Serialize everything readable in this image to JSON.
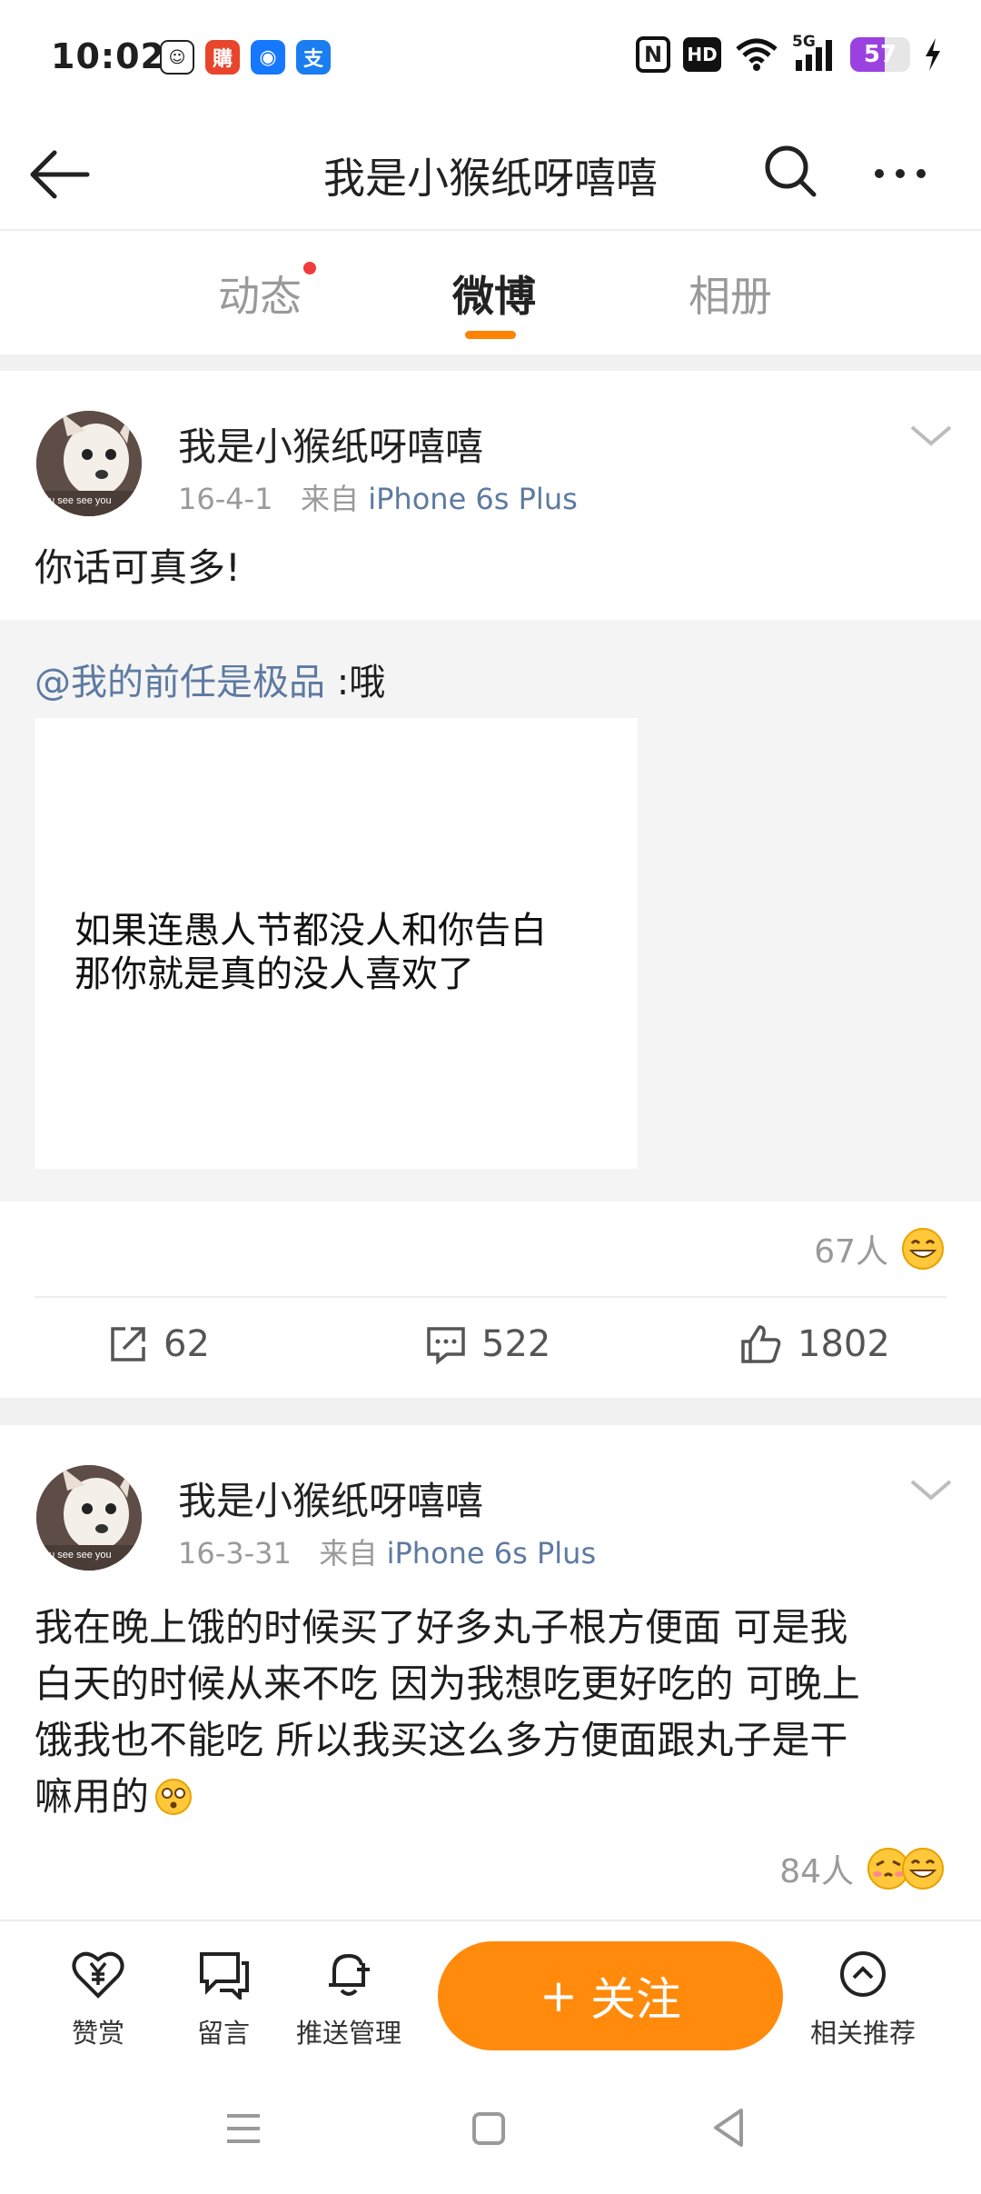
{
  "status_bar": {
    "time": "10:02",
    "app_icons": [
      "wellness-app-icon",
      "shopping-app-icon",
      "alipay-icon",
      "fund-app-icon"
    ],
    "nfc_label": "N",
    "hd_label": "HD",
    "network": "5G",
    "battery_level": 57,
    "battery_label": "57"
  },
  "header": {
    "title": "我是小猴纸呀嘻嘻"
  },
  "tabs": [
    {
      "label": "动态",
      "has_dot": true
    },
    {
      "label": "微博",
      "active": true
    },
    {
      "label": "相册"
    }
  ],
  "posts": [
    {
      "author": "我是小猴纸呀嘻嘻",
      "date": "16-4-1",
      "from_label": "来自",
      "source": "iPhone 6s Plus",
      "text": "你话可真多!",
      "repost": {
        "mention": "@我的前任是极品",
        "text": " :哦",
        "image_caption_1": "如果连愚人节都没人和你告白",
        "image_caption_2": "那你就是真的没人喜欢了"
      },
      "reactions": "67人",
      "shares": "62",
      "comments": "522",
      "likes": "1802"
    },
    {
      "author": "我是小猴纸呀嘻嘻",
      "date": "16-3-31",
      "from_label": "来自",
      "source": "iPhone 6s Plus",
      "text_lines": [
        "我在晚上饿的时候买了好多丸子根方便面 可是我",
        "白天的时候从来不吃 因为我想吃更好吃的 可晚上",
        "饿我也不能吃 所以我买这么多方便面跟丸子是干",
        "嘛用的"
      ],
      "reactions": "84人"
    }
  ],
  "bottom_bar": {
    "reward": "赞赏",
    "message": "留言",
    "push": "推送管理",
    "follow": "关注",
    "follow_plus": "+",
    "related": "相关推荐"
  },
  "colors": {
    "accent": "#ff8200",
    "link": "#5d7aa1",
    "battery": "#9a41e0"
  }
}
